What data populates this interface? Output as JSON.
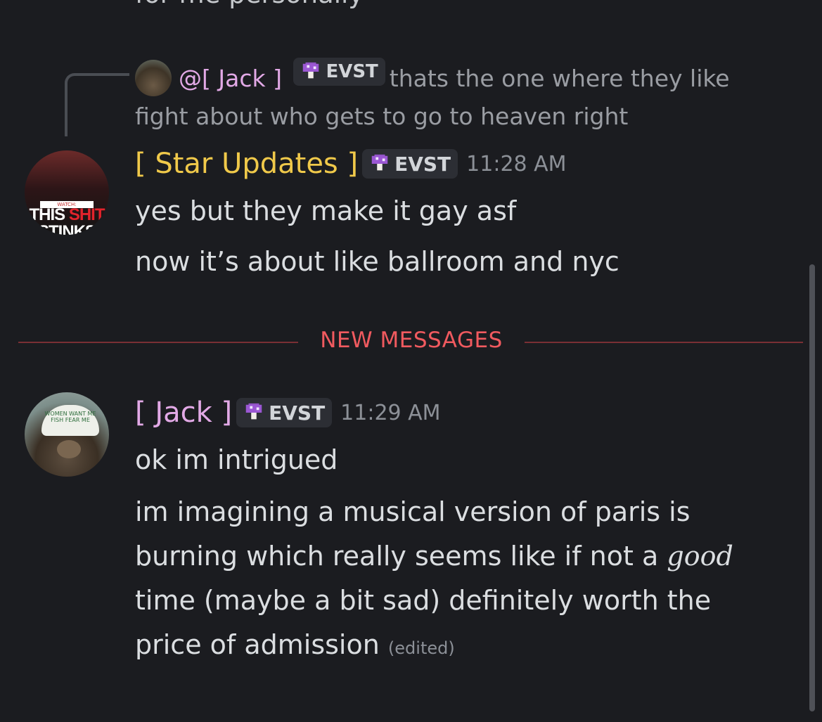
{
  "top_partial_text": "for me personally",
  "reply": {
    "mention": "@[ Jack ]",
    "tag": "EVST",
    "text": "thats the one where they like fight about who gets to go to heaven right"
  },
  "messages": [
    {
      "author": "[ Star Updates ]",
      "tag": "EVST",
      "time": "11:28 AM",
      "avatar_text": {
        "watch": "WATCH:",
        "line1a": "THIS ",
        "line1b": "SHIT",
        "line2": "STINKS"
      },
      "lines": [
        "yes but they make it gay asf",
        "now it’s about like ballroom and nyc"
      ]
    },
    {
      "author": "[ Jack ]",
      "tag": "EVST",
      "time": "11:29 AM",
      "avatar_text": {
        "cap": "WOMEN WANT ME FISH FEAR ME"
      },
      "lines": [
        "ok im intrigued"
      ],
      "paragraph": {
        "before": "im imagining a musical version of paris is burning which really seems like if not a ",
        "emphasis": "good",
        "after": " time (maybe a bit sad) definitely worth the price of admission",
        "edited": "(edited)"
      }
    }
  ],
  "divider_label": "NEW MESSAGES",
  "colors": {
    "background": "#1b1c20",
    "star_name": "#f0c94a",
    "jack_name": "#e2a9e6",
    "divider": "#f05a5f"
  },
  "icons": {
    "tag_icon": "mushroom-icon"
  }
}
